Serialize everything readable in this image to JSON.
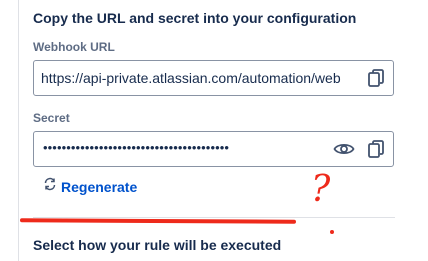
{
  "section": {
    "heading": "Copy the URL and secret into your configuration",
    "webhook_url": {
      "label": "Webhook URL",
      "value": "https://api-private.atlassian.com/automation/web",
      "copy_icon": "copy-icon"
    },
    "secret": {
      "label": "Secret",
      "masked_value": "••••••••••••••••••••••••••••••••••••••••",
      "show_icon": "eye-icon",
      "copy_icon": "copy-icon"
    },
    "regenerate": {
      "label": "Regenerate",
      "icon": "refresh-icon"
    },
    "next_heading": "Select how your rule will be executed"
  },
  "annotation": {
    "text": "?",
    "color": "#ee2a1b"
  },
  "colors": {
    "heading": "#172b4d",
    "label": "#5e6c84",
    "link": "#0052cc",
    "border": "#8993a4",
    "divider": "#dfe1e6",
    "annotation": "#ee2a1b"
  }
}
